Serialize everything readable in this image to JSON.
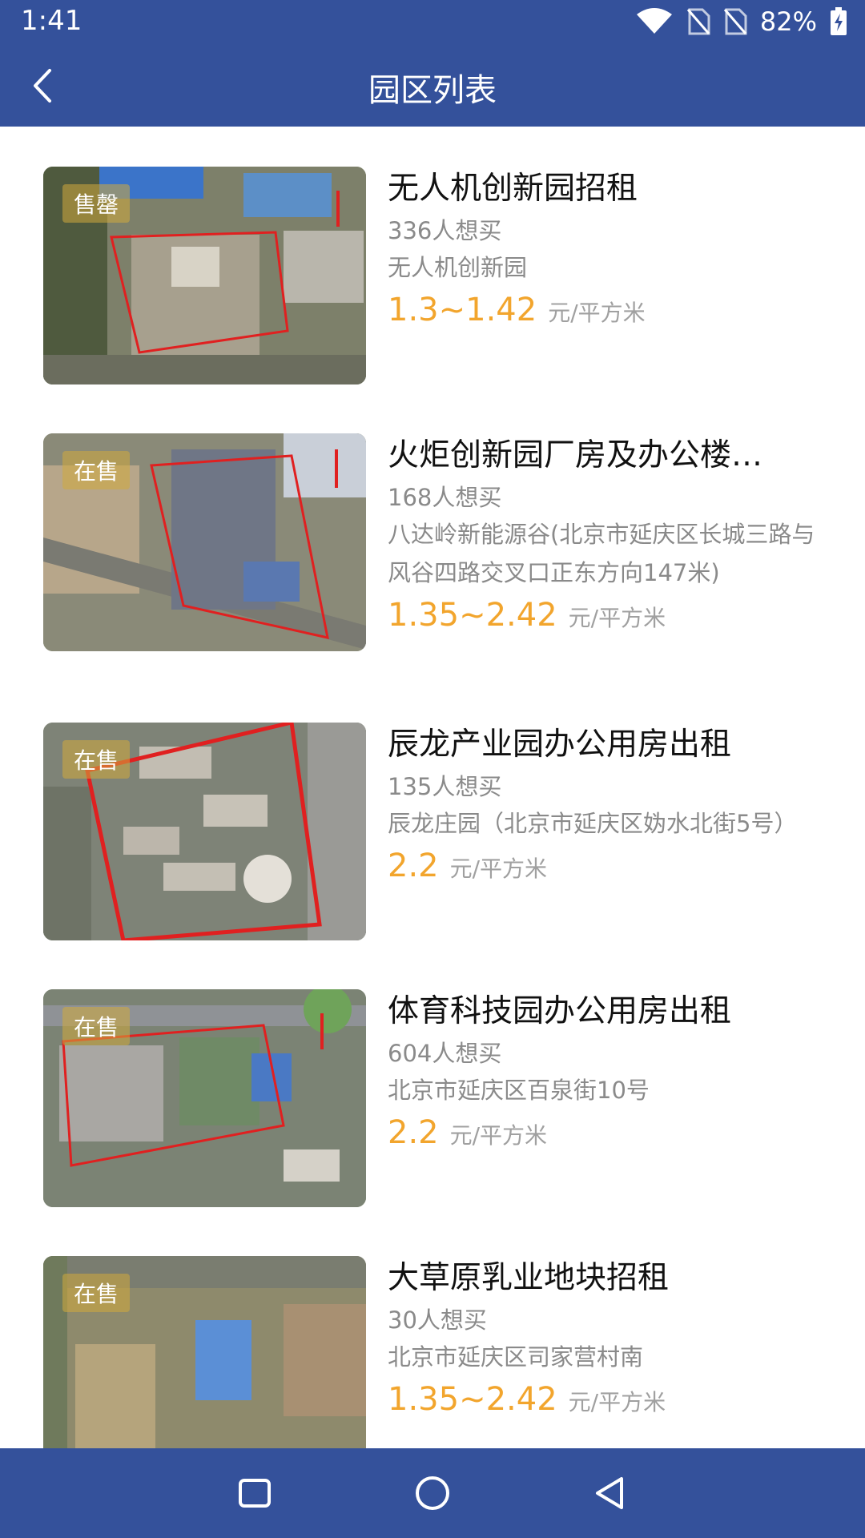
{
  "status_bar": {
    "time": "1:41",
    "battery": "82%"
  },
  "app_bar": {
    "title": "园区列表"
  },
  "colors": {
    "primary": "#34519b",
    "price": "#f2a52d",
    "muted": "#8a8a8a"
  },
  "items": [
    {
      "badge": "售罄",
      "name": "无人机创新园招租",
      "want": "336人想买",
      "address": "无人机创新园",
      "price": "1.3~1.42",
      "unit": "元/平方米"
    },
    {
      "badge": "在售",
      "name": "火炬创新园厂房及办公楼…",
      "want": "168人想买",
      "address": "八达岭新能源谷(北京市延庆区长城三路与风谷四路交叉口正东方向147米)",
      "price": "1.35~2.42",
      "unit": "元/平方米"
    },
    {
      "badge": "在售",
      "name": "辰龙产业园办公用房出租",
      "want": "135人想买",
      "address": "辰龙庄园（北京市延庆区妫水北街5号）",
      "price": "2.2",
      "unit": "元/平方米"
    },
    {
      "badge": "在售",
      "name": "体育科技园办公用房出租",
      "want": "604人想买",
      "address": "北京市延庆区百泉街10号",
      "price": "2.2",
      "unit": "元/平方米"
    },
    {
      "badge": "在售",
      "name": "大草原乳业地块招租",
      "want": "30人想买",
      "address": "北京市延庆区司家营村南",
      "price": "1.35~2.42",
      "unit": "元/平方米"
    }
  ]
}
